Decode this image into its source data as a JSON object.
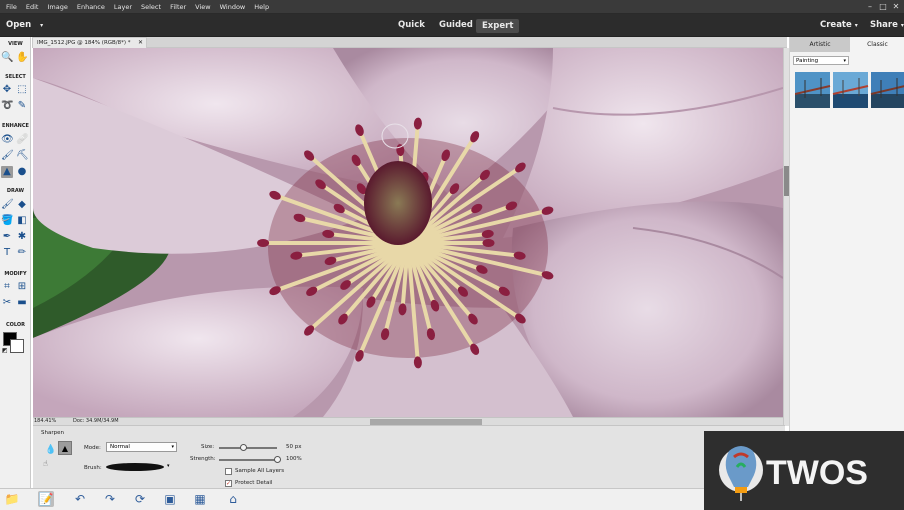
{
  "menu": [
    "File",
    "Edit",
    "Image",
    "Enhance",
    "Layer",
    "Select",
    "Filter",
    "View",
    "Window",
    "Help"
  ],
  "window_controls": {
    "minimize": "–",
    "maximize": "□",
    "close": "✕"
  },
  "modebar": {
    "open": "Open",
    "modes": [
      "Quick",
      "Guided",
      "Expert"
    ],
    "active_mode": "Expert",
    "create": "Create",
    "share": "Share"
  },
  "toolbar": {
    "sections": [
      "VIEW",
      "SELECT",
      "ENHANCE",
      "DRAW",
      "MODIFY",
      "COLOR"
    ]
  },
  "document": {
    "tab_title": "IMG_1512.JPG @ 184% (RGB/8*) *",
    "zoom": "184.41%",
    "doc_size": "Doc: 34.9M/34.9M"
  },
  "panel": {
    "tabs": [
      "Artistic",
      "Classic"
    ],
    "active_tab": "Classic",
    "category": "Painting"
  },
  "options": {
    "tool_name": "Sharpen",
    "mode_label": "Mode:",
    "mode_value": "Normal",
    "brush_label": "Brush:",
    "size_label": "Size:",
    "size_value": "50 px",
    "size_level": 0.42,
    "strength_label": "Strength:",
    "strength_value": "100%",
    "strength_level": 1.0,
    "sample_all_layers": "Sample All Layers",
    "sample_all_layers_checked": false,
    "protect_detail": "Protect Detail",
    "protect_detail_checked": true
  },
  "watermark": {
    "brand": "TWOS"
  },
  "colors": {
    "menubar": "#3a3a3a",
    "modebar": "#2c2c2c",
    "accent": "#1a4f8c",
    "petal": "#d9c9d6",
    "stamen": "#8a1f40"
  }
}
